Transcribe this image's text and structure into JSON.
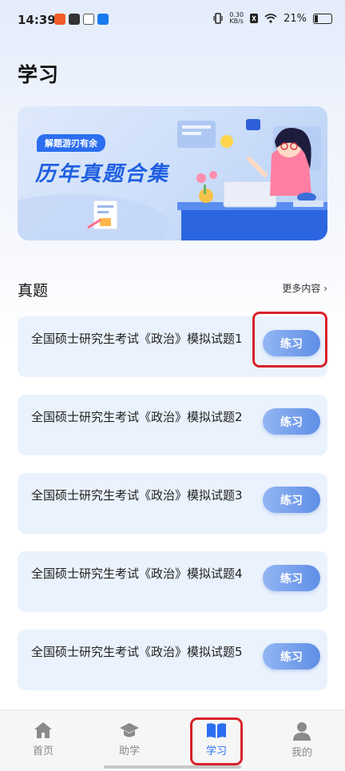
{
  "status_bar": {
    "time": "14:39",
    "net_speed_value": "0.30",
    "net_speed_unit": "KB/s",
    "battery": "21%",
    "app_icon_colors": [
      "#f25c2a",
      "#333333",
      "#555555",
      "#1a7bf0"
    ]
  },
  "page": {
    "title": "学习"
  },
  "banner": {
    "tag": "解题游刃有余",
    "title": "历年真题合集"
  },
  "section": {
    "title": "真题",
    "more_label": "更多内容 ›"
  },
  "items": [
    {
      "title": "全国硕士研究生考试《政治》模拟试题1",
      "button": "练习"
    },
    {
      "title": "全国硕士研究生考试《政治》模拟试题2",
      "button": "练习"
    },
    {
      "title": "全国硕士研究生考试《政治》模拟试题3",
      "button": "练习"
    },
    {
      "title": "全国硕士研究生考试《政治》模拟试题4",
      "button": "练习"
    },
    {
      "title": "全国硕士研究生考试《政治》模拟试题5",
      "button": "练习"
    }
  ],
  "tabs": [
    {
      "label": "首页",
      "icon": "home-icon",
      "active": false
    },
    {
      "label": "助学",
      "icon": "graduation-cap-icon",
      "active": false
    },
    {
      "label": "学习",
      "icon": "book-icon",
      "active": true
    },
    {
      "label": "我的",
      "icon": "user-icon",
      "active": false
    }
  ],
  "colors": {
    "accent": "#2b6ef0",
    "highlight": "#d8222a",
    "card_bg": "#eaf2fd"
  }
}
